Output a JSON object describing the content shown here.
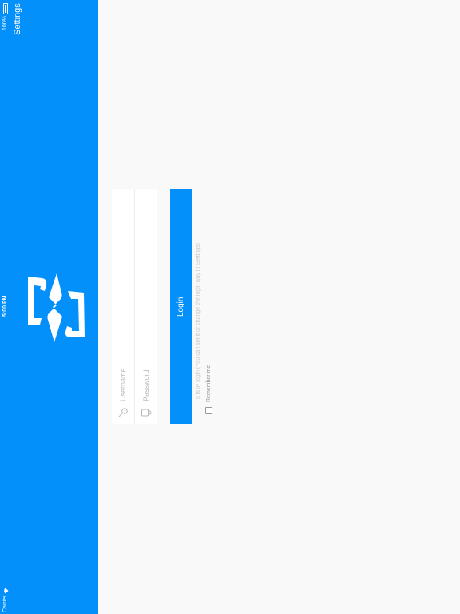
{
  "status_bar": {
    "carrier": "Carrier",
    "time": "5:00 PM",
    "battery": "100%"
  },
  "sidebar": {
    "settings_label": "Settings"
  },
  "login_form": {
    "username_placeholder": "Username",
    "password_placeholder": "Password",
    "login_label": "Login",
    "hint": "It is IP login (You can set it or change the login way in Settings)",
    "remember_label": "Remember me",
    "remember_checked": false
  },
  "colors": {
    "brand_blue": "#0490fb",
    "background": "#f9f9f9"
  },
  "icons": [
    "wifi-icon",
    "battery-icon",
    "app-logo-icon",
    "user-icon",
    "lock-icon",
    "checkbox-icon"
  ]
}
